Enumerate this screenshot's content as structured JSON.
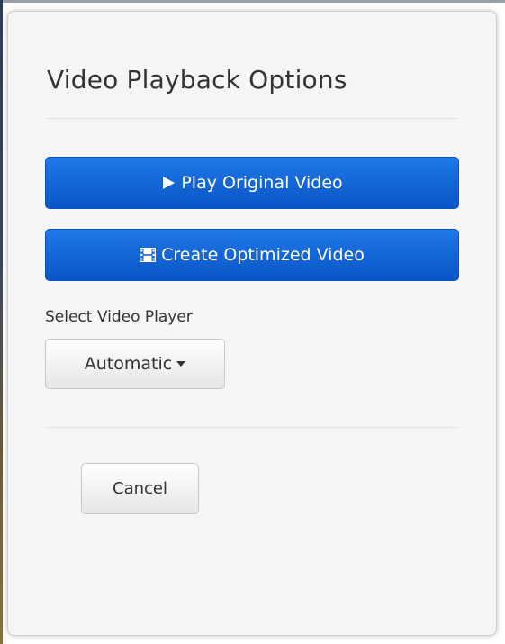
{
  "dialog": {
    "title": "Video Playback Options",
    "play_button": {
      "label": "Play Original Video",
      "icon": "play-icon"
    },
    "create_button": {
      "label": "Create Optimized Video",
      "icon": "film-icon"
    },
    "player_label": "Select Video Player",
    "player_select": {
      "selected": "Automatic",
      "icon": "caret-down-icon"
    },
    "cancel_label": "Cancel"
  },
  "colors": {
    "primary": "#0a55c8",
    "primary_light": "#1f78e6",
    "text": "#333333",
    "panel": "#f5f5f5"
  }
}
